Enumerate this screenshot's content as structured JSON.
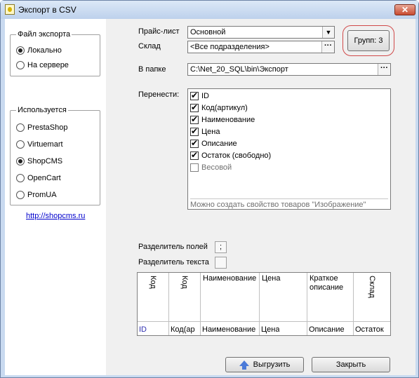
{
  "window": {
    "title": "Экспорт в CSV",
    "close_label": "✕"
  },
  "export_file": {
    "title": "Файл экспорта",
    "options": [
      {
        "label": "Локально",
        "selected": true
      },
      {
        "label": "На сервере",
        "selected": false
      }
    ]
  },
  "platform": {
    "title": "Используется",
    "options": [
      {
        "label": "PrestaShop",
        "selected": false
      },
      {
        "label": "Virtuemart",
        "selected": false
      },
      {
        "label": "ShopCMS",
        "selected": true
      },
      {
        "label": "OpenCart",
        "selected": false
      },
      {
        "label": "PromUA",
        "selected": false
      }
    ]
  },
  "site_link": "http://shopcms.ru",
  "form": {
    "price_list_label": "Прайс-лист",
    "price_list_value": "Основной",
    "warehouse_label": "Склад",
    "warehouse_value": "<Все подразделения>",
    "folder_label": "В папке",
    "folder_value": "C:\\Net_20_SQL\\bin\\Экспорт",
    "groups_button": "Групп: 3"
  },
  "transfer": {
    "label": "Перенести:",
    "items": [
      {
        "label": "ID",
        "checked": true
      },
      {
        "label": "Код(артикул)",
        "checked": true
      },
      {
        "label": "Наименование",
        "checked": true
      },
      {
        "label": "Цена",
        "checked": true
      },
      {
        "label": "Описание",
        "checked": true
      },
      {
        "label": "Остаток (свободно)",
        "checked": true
      },
      {
        "label": "Весовой",
        "checked": false
      }
    ],
    "hint": "Можно создать свойство товаров \"Изображение\""
  },
  "separators": {
    "field_label": "Разделитель полей",
    "field_value": ";",
    "text_label": "Разделитель текста",
    "text_value": ""
  },
  "preview": {
    "headers": [
      "Код",
      "Код",
      "Наименование",
      "Цена",
      "Краткое описание",
      "Склад"
    ],
    "row": [
      "ID",
      "Код(ар",
      "Наименование",
      "Цена",
      "Описание",
      "Остаток"
    ]
  },
  "buttons": {
    "export": "Выгрузить",
    "close": "Закрыть"
  },
  "colors": {
    "accent": "#0000cc",
    "highlight_ring": "#d04a4a"
  }
}
